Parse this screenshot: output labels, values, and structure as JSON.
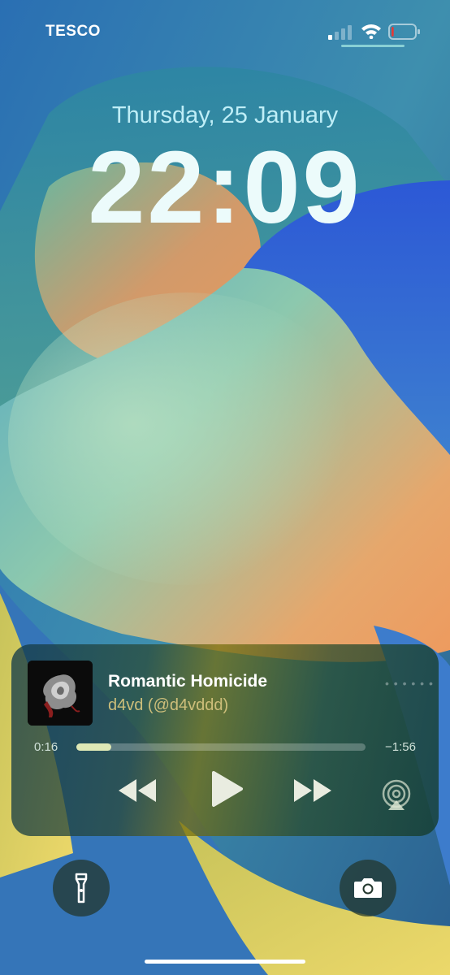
{
  "status_bar": {
    "carrier": "TESCO",
    "signal_bars_active": 1,
    "signal_bars_total": 4,
    "wifi_icon": "wifi-icon",
    "battery_level": 0.1,
    "battery_color": "#e53935"
  },
  "lock": {
    "date": "Thursday, 25 January",
    "time": "22:09"
  },
  "now_playing": {
    "title": "Romantic Homicide",
    "artist": "d4vd (@d4vddd)",
    "elapsed": "0:16",
    "remaining": "−1:56",
    "progress": 0.12,
    "icons": [
      "backward-icon",
      "play-icon",
      "forward-icon",
      "airplay-icon"
    ]
  },
  "quick_actions": {
    "left_icon": "flashlight-icon",
    "right_icon": "camera-icon"
  },
  "colors": {
    "accent_date": "#bfeef7",
    "artist_text": "#cdbe7a",
    "progress_fill": "#dfe8b5"
  }
}
